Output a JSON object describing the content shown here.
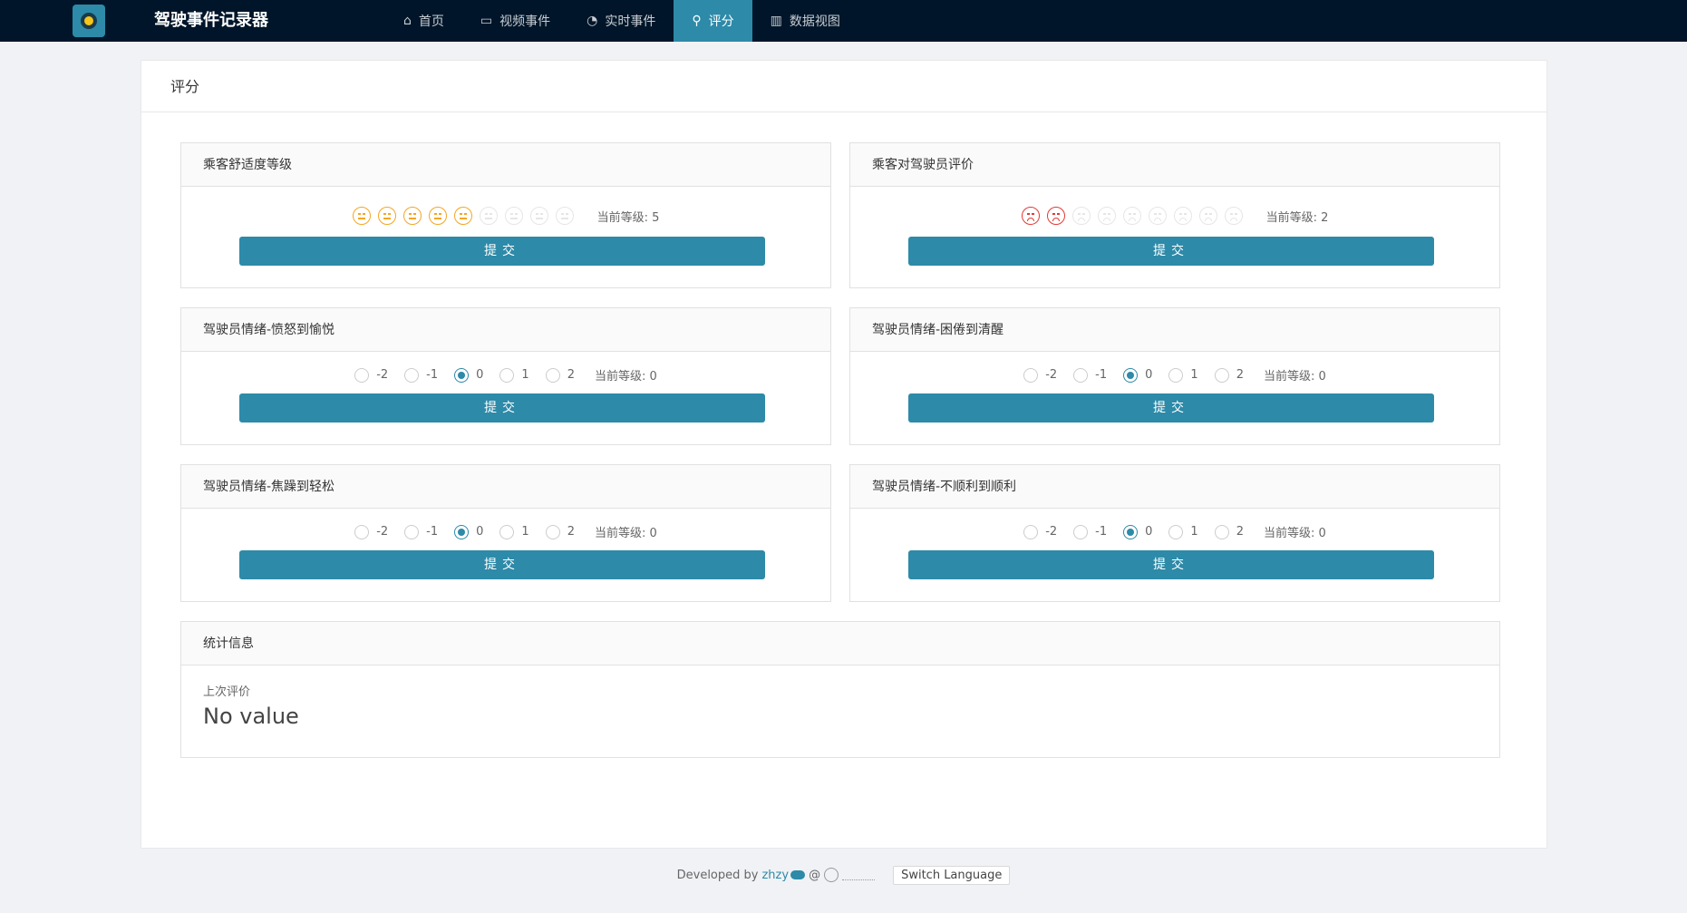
{
  "nav": {
    "brand": "驾驶事件记录器",
    "items": [
      {
        "icon": "home-icon",
        "glyph": "⌂",
        "label": "首页"
      },
      {
        "icon": "video-icon",
        "glyph": "▭",
        "label": "视频事件"
      },
      {
        "icon": "dashboard-icon",
        "glyph": "◔",
        "label": "实时事件"
      },
      {
        "icon": "rating-icon",
        "glyph": "⚲",
        "label": "评分",
        "active": true
      },
      {
        "icon": "chart-icon",
        "glyph": "▥",
        "label": "数据视图"
      }
    ]
  },
  "page": {
    "title": "评分"
  },
  "comfort": {
    "title": "乘客舒适度等级",
    "max": 9,
    "value": 5,
    "level_text": "当前等级: 5",
    "submit": "提交"
  },
  "driver_review": {
    "title": "乘客对驾驶员评价",
    "max": 9,
    "value": 2,
    "level_text": "当前等级: 2",
    "submit": "提交"
  },
  "mood_panels": [
    {
      "title": "驾驶员情绪-愤怒到愉悦",
      "options": [
        "-2",
        "-1",
        "0",
        "1",
        "2"
      ],
      "selected": "0",
      "level_text": "当前等级: 0",
      "submit": "提交"
    },
    {
      "title": "驾驶员情绪-困倦到清醒",
      "options": [
        "-2",
        "-1",
        "0",
        "1",
        "2"
      ],
      "selected": "0",
      "level_text": "当前等级: 0",
      "submit": "提交"
    },
    {
      "title": "驾驶员情绪-焦躁到轻松",
      "options": [
        "-2",
        "-1",
        "0",
        "1",
        "2"
      ],
      "selected": "0",
      "level_text": "当前等级: 0",
      "submit": "提交"
    },
    {
      "title": "驾驶员情绪-不顺利到顺利",
      "options": [
        "-2",
        "-1",
        "0",
        "1",
        "2"
      ],
      "selected": "0",
      "level_text": "当前等级: 0",
      "submit": "提交"
    }
  ],
  "stats": {
    "title": "统计信息",
    "last_label": "上次评价",
    "last_value": "No value"
  },
  "footer": {
    "developed_by": "Developed by",
    "author": "zhzy",
    "at": "@",
    "switch_language": "Switch Language"
  },
  "colors": {
    "accent": "#2d8aa8",
    "nav_bg": "#001529",
    "happy": "#f5a623",
    "sad": "#e53935"
  }
}
